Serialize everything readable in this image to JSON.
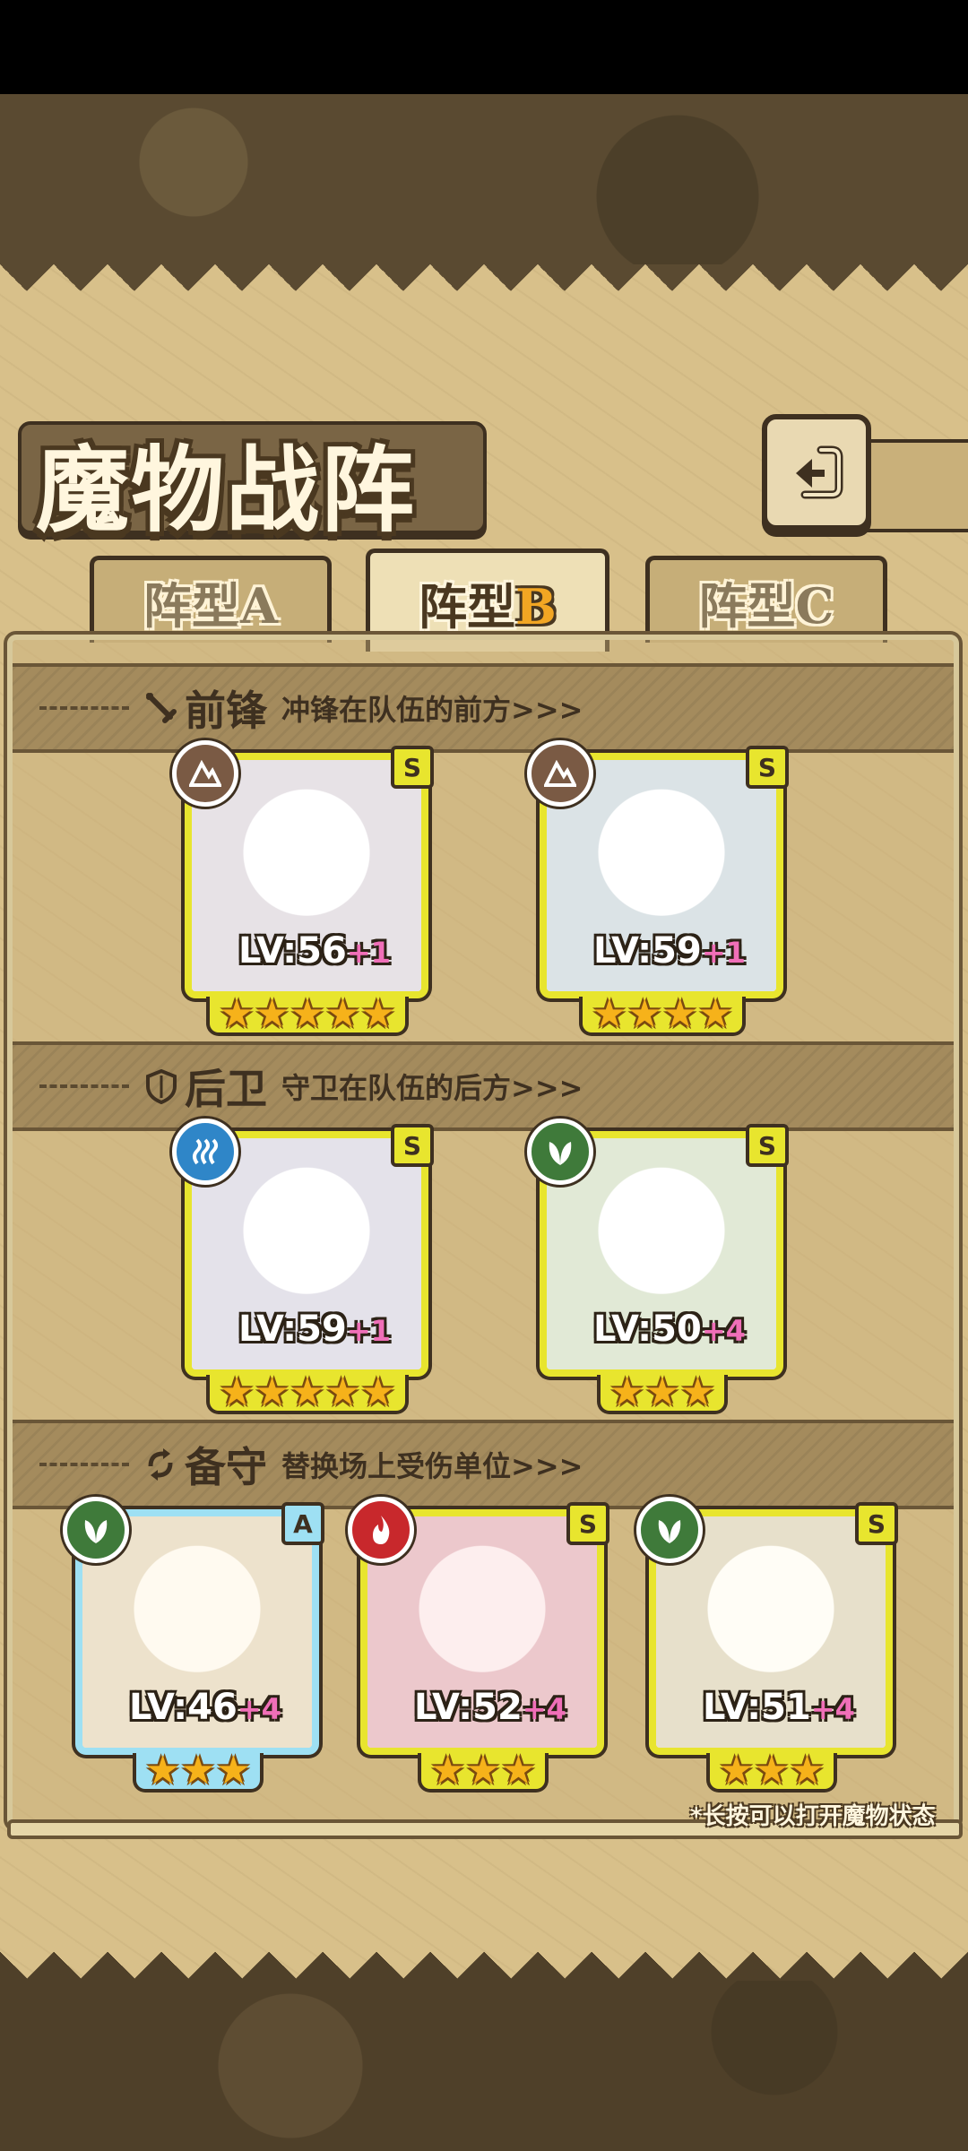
{
  "header": {
    "title": "魔物战阵"
  },
  "tabs": [
    {
      "prefix": "阵型",
      "letter": "A",
      "active": false
    },
    {
      "prefix": "阵型",
      "letter": "B",
      "active": true
    },
    {
      "prefix": "阵型",
      "letter": "C",
      "active": false
    }
  ],
  "sections": {
    "front": {
      "title": "前锋",
      "desc": "冲锋在队伍的前方>>>"
    },
    "rear": {
      "title": "后卫",
      "desc": "守卫在队伍的后方>>>"
    },
    "reserve": {
      "title": "备守",
      "desc": "替换场上受伤单位>>>"
    }
  },
  "cards": {
    "front": [
      {
        "level": "LV:56",
        "plus": "+1",
        "rank": "S",
        "element": "rock-element-icon",
        "element_color": "#7a5a44",
        "stars": "★★★★★",
        "art_color": "#f4f0f2"
      },
      {
        "level": "LV:59",
        "plus": "+1",
        "rank": "S",
        "element": "rock-element-icon",
        "element_color": "#7a5a44",
        "stars": "★★★★",
        "art_color": "#e8eef0"
      }
    ],
    "rear": [
      {
        "level": "LV:59",
        "plus": "+1",
        "rank": "S",
        "element": "water-element-icon",
        "element_color": "#2f86c8",
        "stars": "★★★★★",
        "art_color": "#f2f0f4"
      },
      {
        "level": "LV:50",
        "plus": "+4",
        "rank": "S",
        "element": "leaf-element-icon",
        "element_color": "#3f7a3a",
        "stars": "★★★",
        "art_color": "#eef2e6"
      }
    ],
    "reserve": [
      {
        "level": "LV:46",
        "plus": "+4",
        "rank": "A",
        "element": "leaf-element-icon",
        "element_color": "#3f7a3a",
        "stars": "★★★",
        "art_color": "#f2ead8"
      },
      {
        "level": "LV:52",
        "plus": "+4",
        "rank": "S",
        "element": "fire-element-icon",
        "element_color": "#c8282c",
        "stars": "★★★",
        "art_color": "#f3dcdc"
      },
      {
        "level": "LV:51",
        "plus": "+4",
        "rank": "S",
        "element": "leaf-element-icon",
        "element_color": "#3f7a3a",
        "stars": "★★★",
        "art_color": "#f3efe2"
      }
    ]
  },
  "footer": {
    "hint": "*长按可以打开魔物状态"
  }
}
